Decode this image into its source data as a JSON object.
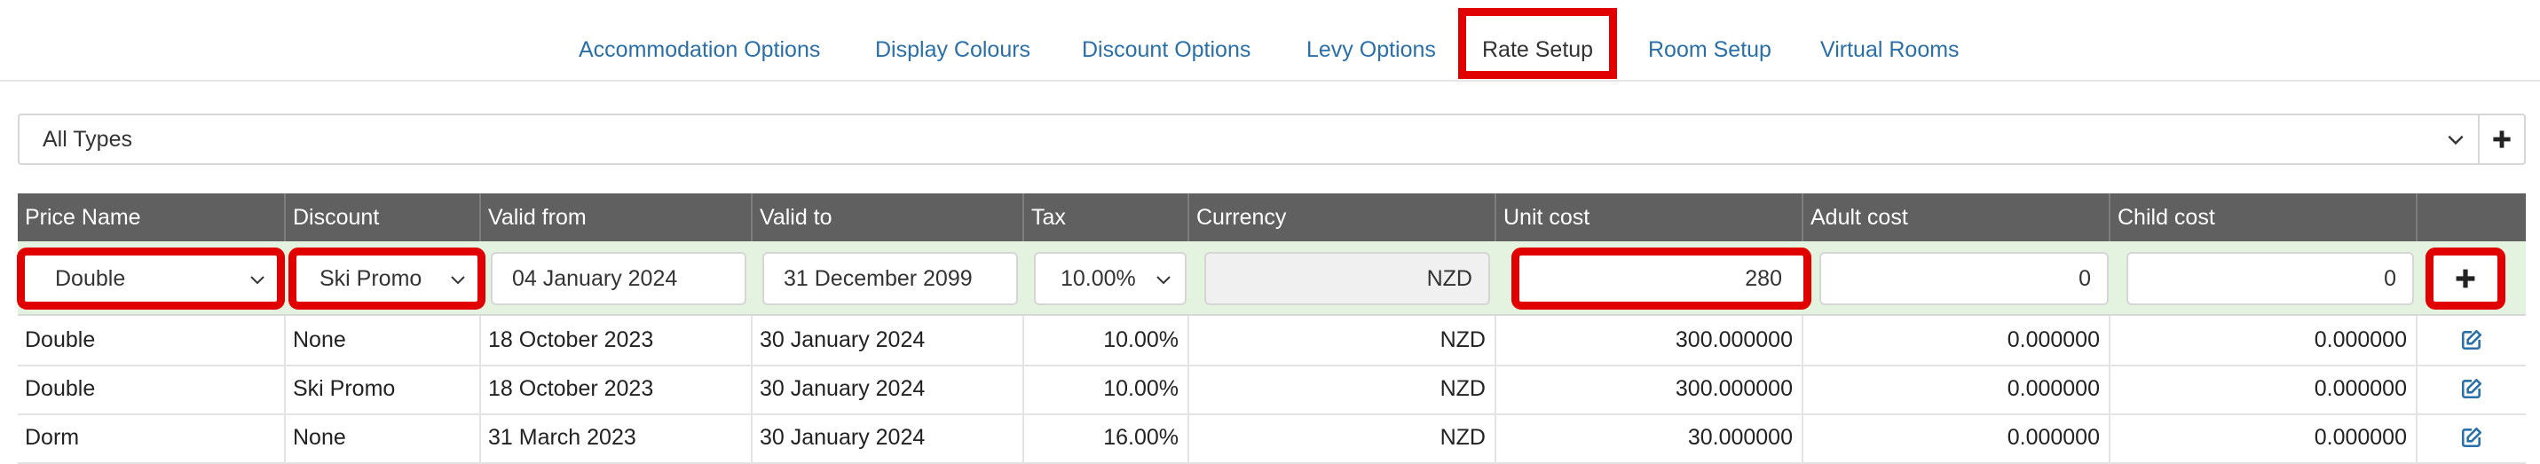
{
  "tabs": [
    {
      "label": "Accommodation Options",
      "active": false
    },
    {
      "label": "Display Colours",
      "active": false
    },
    {
      "label": "Discount Options",
      "active": false
    },
    {
      "label": "Levy Options",
      "active": false
    },
    {
      "label": "Rate Setup",
      "active": true
    },
    {
      "label": "Room Setup",
      "active": false
    },
    {
      "label": "Virtual Rooms",
      "active": false
    }
  ],
  "type_filter": {
    "value": "All Types",
    "chevron_icon": "chevron-down-icon",
    "add_icon": "plus-icon"
  },
  "table": {
    "columns": [
      "Price Name",
      "Discount",
      "Valid from",
      "Valid to",
      "Tax",
      "Currency",
      "Unit cost",
      "Adult cost",
      "Child cost",
      ""
    ],
    "new_rate": {
      "price_name": "Double",
      "discount": "Ski Promo",
      "valid_from": "04 January 2024",
      "valid_to": "31 December 2099",
      "tax": "10.00%",
      "currency": "NZD",
      "unit_cost": "280",
      "adult_cost": "0",
      "child_cost": "0",
      "add_icon": "plus-icon"
    },
    "rows": [
      {
        "price_name": "Double",
        "discount": "None",
        "valid_from": "18 October 2023",
        "valid_to": "30 January 2024",
        "tax": "10.00%",
        "currency": "NZD",
        "unit_cost": "300.000000",
        "adult_cost": "0.000000",
        "child_cost": "0.000000",
        "edit_icon": "edit-icon"
      },
      {
        "price_name": "Double",
        "discount": "Ski Promo",
        "valid_from": "18 October 2023",
        "valid_to": "30 January 2024",
        "tax": "10.00%",
        "currency": "NZD",
        "unit_cost": "300.000000",
        "adult_cost": "0.000000",
        "child_cost": "0.000000",
        "edit_icon": "edit-icon"
      },
      {
        "price_name": "Dorm",
        "discount": "None",
        "valid_from": "31 March 2023",
        "valid_to": "30 January 2024",
        "tax": "16.00%",
        "currency": "NZD",
        "unit_cost": "30.000000",
        "adult_cost": "0.000000",
        "child_cost": "0.000000",
        "edit_icon": "edit-icon"
      }
    ]
  },
  "colors": {
    "link": "#2a6fa8",
    "highlight": "#e00000",
    "header_bg": "#606060",
    "edit_row_bg": "#e4f3df"
  }
}
